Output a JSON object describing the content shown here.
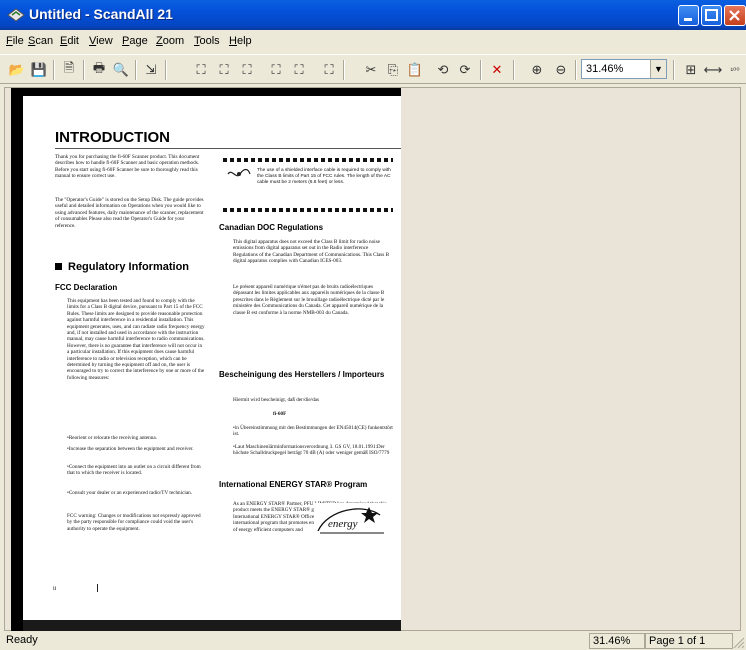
{
  "window": {
    "title": "Untitled - ScandAll 21"
  },
  "menu": [
    {
      "label": "File",
      "u": "F",
      "rest": "ile"
    },
    {
      "label": "Scan",
      "u": "S",
      "rest": "can"
    },
    {
      "label": "Edit",
      "u": "E",
      "rest": "dit"
    },
    {
      "label": "View",
      "u": "V",
      "rest": "iew"
    },
    {
      "label": "Page",
      "u": "P",
      "rest": "age"
    },
    {
      "label": "Zoom",
      "u": "Z",
      "rest": "oom"
    },
    {
      "label": "Tools",
      "u": "T",
      "rest": "ools"
    },
    {
      "label": "Help",
      "u": "H",
      "rest": "elp"
    }
  ],
  "toolbar": {
    "zoom_value": "31.46%"
  },
  "document": {
    "title": "INTRODUCTION",
    "intro1": "Thank you for purchasing the fi-60F Scanner product. This document describes how to handle fi-60F Scanner and basic operation methods. Before you start using fi-60F Scanner be sure to thoroughly read this manual to ensure correct use.",
    "intro2": "The \"Operator's Guide\" is stored on the Setup Disk. The guide provides useful and detailed information on Operations when you would like to using advanced features, daily maintenance of the scanner, replacement of consumables Please also read the Operator's Guide for your reference.",
    "regulatory": "Regulatory Information",
    "fcc": "FCC Declaration",
    "fcc_body": "This equipment has been tested and found to comply with the limits for a Class B digital device, pursuant to Part 15 of the FCC Rules. These limits are designed to provide reasonable protection against harmful interference in a residential installation. This equipment generates, uses, and can radiate radio frequency energy and, if not installed and used in accordance with the instruction manual, may cause harmful interference to radio communications. However, there is no guarantee that interference will not occur in a particular installation. If this equipment does cause harmful interference to radio or television reception, which can be determined by turning the equipment off and on, the user is encouraged to try to correct the interference by one or more of the following measures:",
    "bullet1": "•Reorient or relocate the receiving antenna.",
    "bullet2": "•Increase the separation between the equipment and receiver.",
    "bullet3": "•Connect the equipment into an outlet on a circuit different from that to which the receiver is located.",
    "bullet4": "•Consult your dealer or an experienced radio/TV technician.",
    "fcc_warning": "FCC warning: Changes or modifications not expressly approved by the party responsible for compliance could void the user's authority to operate the equipment.",
    "cable_note": "The use of a shielded interface cable is required to comply with the Class B limits of Part 15 of FCC rules. The length of the AC cable must be 2 meters (6.6 feet) or less.",
    "canadian": "Canadian DOC Regulations",
    "canadian_body": "This digital apparatus does not exceed the Class B limit for radio noise emissions from digital apparatus set out in the Radio interference Regulations of the Canadian Department of Communications. This Class B digital apparatus complies with Canadian ICES-003.",
    "french_body": "Le présent appareil numérique n'émet pas de bruits radioélectriques dépassant les limites applicables aux appareils numériques de la classe B prescrites dans le Règlement sur le brouillage radioélectrique dicté par le ministère des Communications du Canada. Cet appareil numérique de la classe B est conforme à la norme NMB-003 du Canada.",
    "german_head": "Bescheinigung des Herstellers / Importeurs",
    "german_1": "Hiermit wird bescheinigt, daß der/die/das",
    "german_model": "fi-60F",
    "german_2": "•in Übereinstimmung mit den Bestimmungen der EN45014(CE) funkentstört ist.",
    "german_3": "•Laut Maschinenlärminformationsverordnung 3. GS GV, 18.01.1991:Der höchste Schalldruckpegel beträgt 70 dB (A) oder weniger gemäß ISO/7779",
    "energy_head": "International ENERGY STAR® Program",
    "energy_body": "As an ENERGY STAR® Partner, PFU LIMITED has determined that this product meets the ENERGY STAR® guidelines for energy efficiency. The International ENERGY STAR® Office Equipment Program is an international program that promotes energy saving through the penetration of energy efficient computers and",
    "energy_logo": "energy",
    "page_num": "ii"
  },
  "status": {
    "ready": "Ready",
    "zoom": "31.46%",
    "page": "Page 1 of 1"
  }
}
